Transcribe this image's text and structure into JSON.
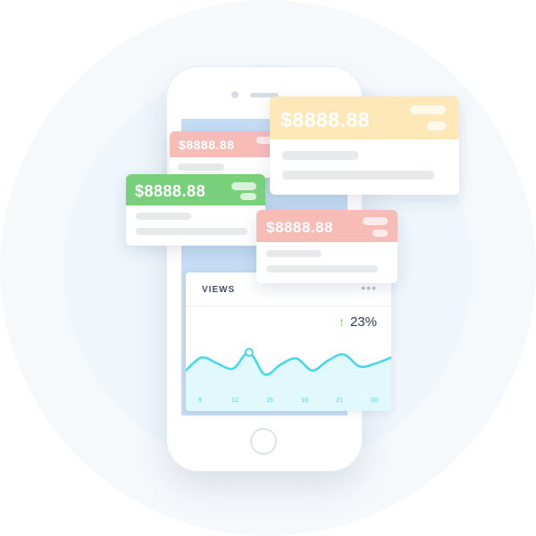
{
  "cards": {
    "back_red": {
      "amount": "$8888.88",
      "color": "#f8bcb7"
    },
    "yellow": {
      "amount": "$8888.88",
      "color": "#ffe8b7"
    },
    "green": {
      "amount": "$8888.88",
      "color": "#78cf7c"
    },
    "front_red": {
      "amount": "$8888.88",
      "color": "#f8bcb7"
    }
  },
  "views_widget": {
    "title": "VIEWS",
    "menu_icon": "more-horizontal-icon",
    "growth_icon": "up-arrow-icon",
    "growth": "23%",
    "accent_color": "#42d8f0",
    "line_values": [
      18,
      31,
      25,
      20,
      36,
      14,
      24,
      30,
      18,
      28,
      34,
      22,
      25,
      31
    ],
    "x_labels": [
      "9",
      "12",
      "15",
      "18",
      "21",
      "00"
    ],
    "highlighted_point_index": 4
  },
  "phone": {
    "icons": [
      "camera-icon",
      "speaker-icon",
      "home-button-icon"
    ]
  }
}
